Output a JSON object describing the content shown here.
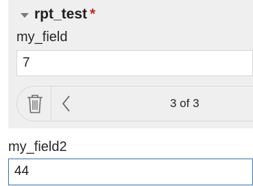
{
  "section": {
    "title": "rpt_test",
    "required_mark": "*",
    "caret_icon": "caret-down-icon"
  },
  "fields": {
    "my_field": {
      "label": "my_field",
      "value": "7"
    },
    "my_field2": {
      "label": "my_field2",
      "value": "44"
    }
  },
  "pager": {
    "delete_icon": "trash-icon",
    "prev_icon": "chevron-left-icon",
    "status": "3 of 3"
  },
  "colors": {
    "panel_bg": "#efefef",
    "required": "#c42b1c",
    "focus_border": "#2f6fb3"
  }
}
